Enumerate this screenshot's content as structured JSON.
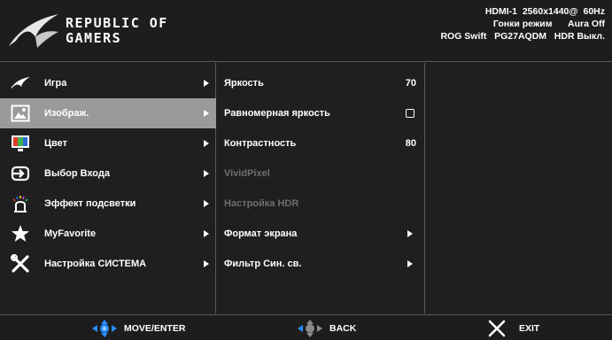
{
  "brand": {
    "line1": "REPUBLIC OF",
    "line2": "GAMERS"
  },
  "status": {
    "row1": "HDMI-1  2560x1440@  60Hz",
    "row2": "Гонки режим      Aura Off",
    "row3": "ROG Swift   PG27AQDM   HDR Выкл."
  },
  "main_menu": [
    {
      "label": "Игра",
      "icon": "rog-eye-icon",
      "selected": false
    },
    {
      "label": "Изображ.",
      "icon": "image-icon",
      "selected": true
    },
    {
      "label": "Цвет",
      "icon": "color-icon",
      "selected": false
    },
    {
      "label": "Выбор Входа",
      "icon": "input-select-icon",
      "selected": false
    },
    {
      "label": "Эффект подсветки",
      "icon": "lighting-effect-icon",
      "selected": false
    },
    {
      "label": "MyFavorite",
      "icon": "star-icon",
      "selected": false
    },
    {
      "label": "Настройка СИСТЕМА",
      "icon": "wrench-screwdriver-icon",
      "selected": false
    }
  ],
  "sub_menu": [
    {
      "label": "Яркость",
      "value": "70",
      "kind": "value",
      "disabled": false
    },
    {
      "label": "Равномерная яркость",
      "value": "",
      "kind": "checkbox",
      "disabled": false
    },
    {
      "label": "Контрастность",
      "value": "80",
      "kind": "value",
      "disabled": false
    },
    {
      "label": "VividPixel",
      "value": "",
      "kind": "none",
      "disabled": true
    },
    {
      "label": "Настройка HDR",
      "value": "",
      "kind": "none",
      "disabled": true
    },
    {
      "label": "Формат экрана",
      "value": "",
      "kind": "arrow",
      "disabled": false
    },
    {
      "label": "Фильтр Син. св.",
      "value": "",
      "kind": "arrow",
      "disabled": false
    }
  ],
  "footer": {
    "move_enter": "MOVE/ENTER",
    "back": "BACK",
    "exit": "EXIT"
  },
  "colors": {
    "background": "#1f1f1f",
    "selected": "#9a9a9a",
    "divider": "#5a5a5a",
    "nav_blue": "#2a8cff",
    "disabled_text": "#6e6e6e"
  }
}
